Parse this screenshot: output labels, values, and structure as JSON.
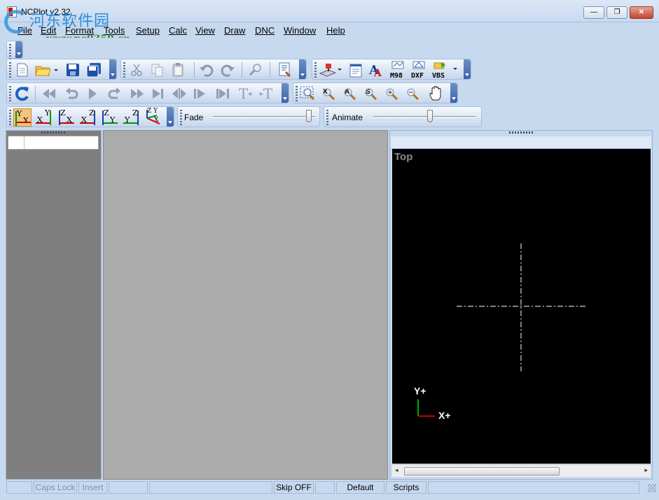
{
  "window": {
    "title": "NCPlot v2.32",
    "controls": {
      "minimize": "—",
      "maximize": "❐",
      "close": "✕"
    }
  },
  "watermark": {
    "site_cn": "河东软件园",
    "url": "www.pc0359.cn"
  },
  "menu": [
    "File",
    "Edit",
    "Format",
    "Tools",
    "Setup",
    "Calc",
    "View",
    "Draw",
    "DNC",
    "Window",
    "Help"
  ],
  "toolbar_file": {
    "icons": [
      "new-file-icon",
      "open-folder-icon",
      "save-icon",
      "save-all-icon"
    ]
  },
  "toolbar_edit": {
    "icons": [
      "cut-icon",
      "copy-icon",
      "paste-icon",
      "undo-icon",
      "redo-icon",
      "find-icon",
      "find-replace-icon"
    ]
  },
  "toolbar_tools": {
    "icons": [
      "machine-icon",
      "notepad-icon",
      "font-icon",
      "m98-icon",
      "dxf-icon",
      "vbs-icon"
    ],
    "labels": {
      "m98": "M98",
      "dxf": "DXF",
      "vbs": "VBS"
    }
  },
  "toolbar_nav": {
    "icons": [
      "refresh-icon",
      "rewind-icon",
      "step-back-icon",
      "play-icon",
      "step-forward-icon",
      "fast-forward-icon",
      "end-icon",
      "split-icon",
      "next-block-icon",
      "last-icon",
      "text-left-icon",
      "text-right-icon"
    ],
    "text_labels": {
      "tl": "T",
      "tr": "T"
    }
  },
  "toolbar_view": {
    "icons": [
      "zoom-window-icon",
      "zoom-x-icon",
      "zoom-a-icon",
      "zoom-s-icon",
      "zoom-in-icon",
      "zoom-out-icon",
      "pan-hand-icon"
    ],
    "letters": {
      "x": "X",
      "a": "A",
      "s": "S"
    }
  },
  "toolbar_planes": {
    "planes": [
      {
        "top": "Y",
        "bottom": "X",
        "active": true
      },
      {
        "top": "Y",
        "bottom": "X"
      },
      {
        "top": "Z",
        "bottom": "X"
      },
      {
        "top": "Z",
        "bottom": "X"
      },
      {
        "top": "Z",
        "bottom": "Y"
      },
      {
        "top": "Z",
        "bottom": "Y"
      },
      {
        "top": "Z Y",
        "bottom": "X"
      }
    ],
    "fade_label": "Fade",
    "fade_level": 0.95,
    "animate_label": "Animate",
    "animate_level": 0.55
  },
  "viewport": {
    "view_label": "Top",
    "axis_y": "Y+",
    "axis_x": "X+"
  },
  "statusbar": {
    "caps_lock": "Caps Lock",
    "insert": "Insert",
    "skip": "Skip OFF",
    "default": "Default",
    "scripts": "Scripts"
  },
  "colors": {
    "accent": "#c7d9ef",
    "axis_x": "#cc0000",
    "axis_y": "#00aa00",
    "viewport_bg": "#000000"
  }
}
